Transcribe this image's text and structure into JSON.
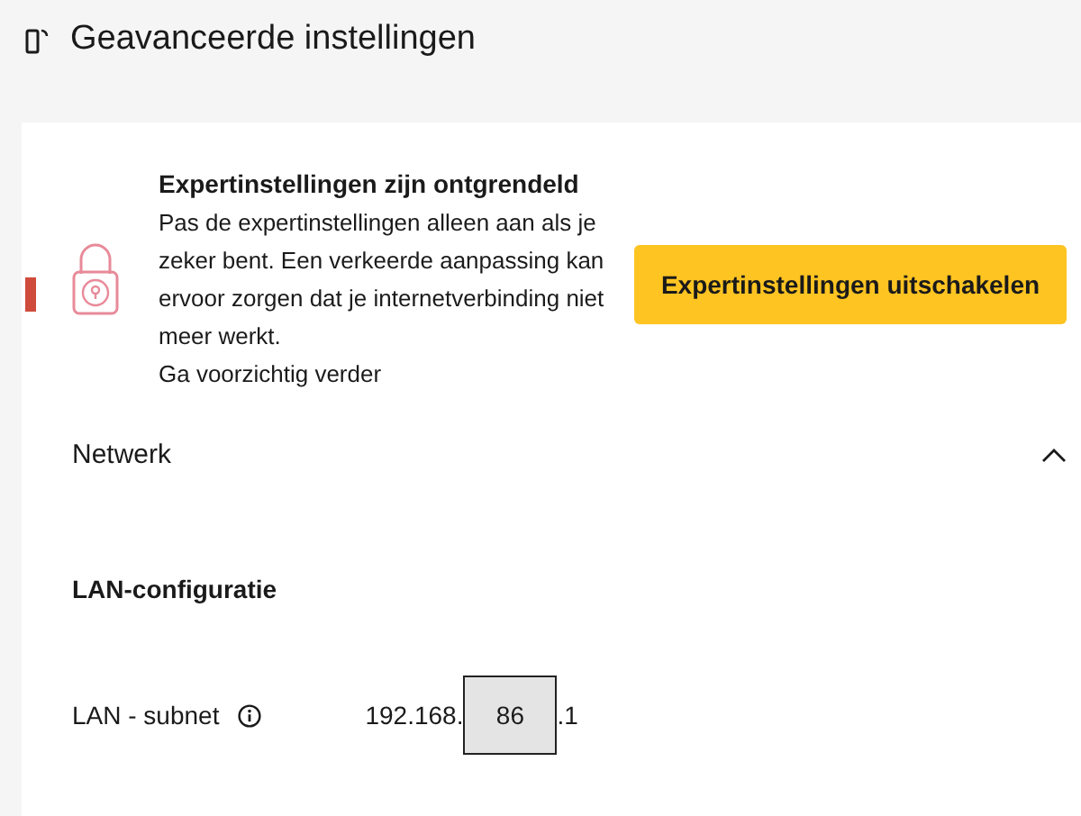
{
  "page": {
    "title": "Geavanceerde instellingen"
  },
  "notice": {
    "title": "Expertinstellingen zijn ontgrendeld",
    "body": "Pas de expertinstellingen alleen aan als je zeker bent. Een verkeerde aanpassing kan ervoor zorgen dat je internetverbinding niet meer werkt.",
    "warning": "Ga voorzichtig verder",
    "button": "Expertinstellingen uitschakelen"
  },
  "section": {
    "title": "Netwerk",
    "expanded": true,
    "subtitle": "LAN-configuratie",
    "fields": [
      {
        "label": "LAN - subnet",
        "prefix": "192.168.",
        "value": "86",
        "suffix": ".1"
      }
    ]
  }
}
